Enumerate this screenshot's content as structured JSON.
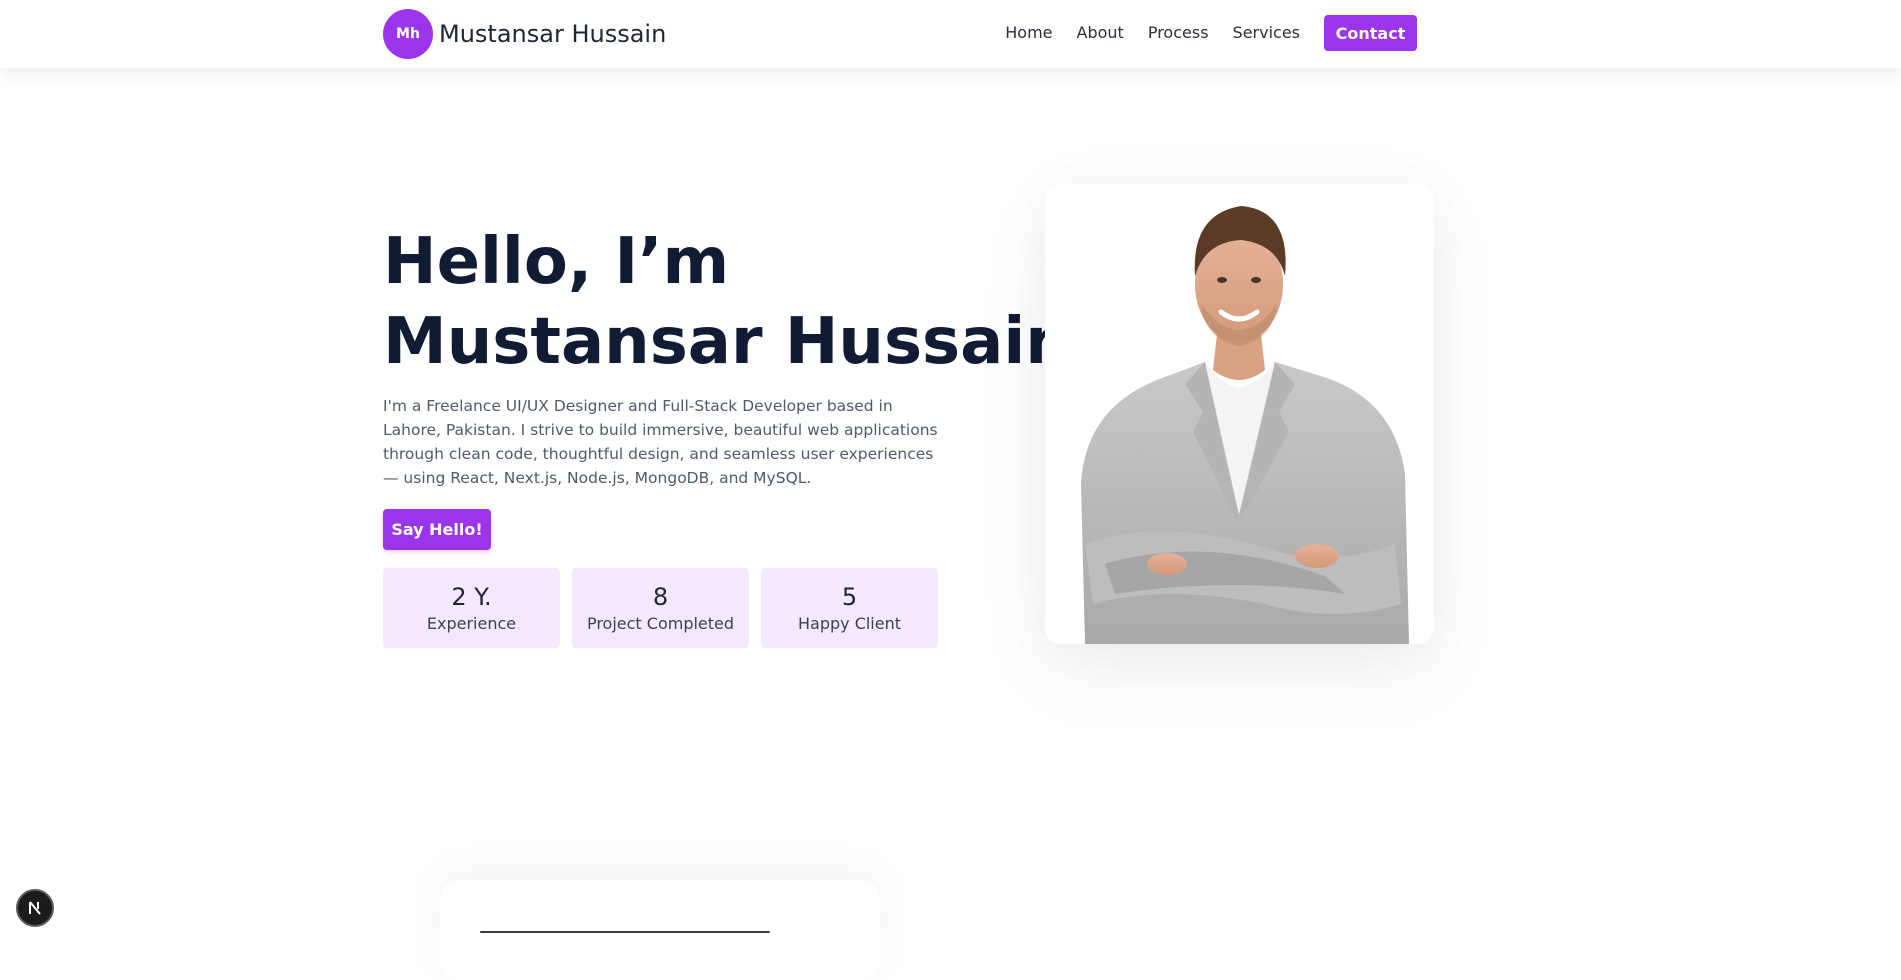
{
  "header": {
    "logo_initials": "Mh",
    "brand_name": "Mustansar Hussain",
    "nav": [
      {
        "label": "Home"
      },
      {
        "label": "About"
      },
      {
        "label": "Process"
      },
      {
        "label": "Services"
      }
    ],
    "contact_label": "Contact"
  },
  "hero": {
    "title_line1": "Hello, I’m",
    "title_line2": "Mustansar Hussain",
    "description": "I'm a Freelance UI/UX Designer and Full-Stack Developer based in Lahore, Pakistan. I strive to build immersive, beautiful web applications through clean code, thoughtful design, and seamless user experiences — using React, Next.js, Node.js, MongoDB, and MySQL.",
    "cta_label": "Say Hello!",
    "stats": [
      {
        "value": "2 Y.",
        "label": "Experience"
      },
      {
        "value": "8",
        "label": "Project Completed"
      },
      {
        "value": "5",
        "label": "Happy Client"
      }
    ]
  },
  "colors": {
    "accent": "#9b35ec",
    "stat_background": "#f5e9fe",
    "heading": "#111b33"
  },
  "icons": {
    "dev_badge": "nextjs-icon"
  }
}
